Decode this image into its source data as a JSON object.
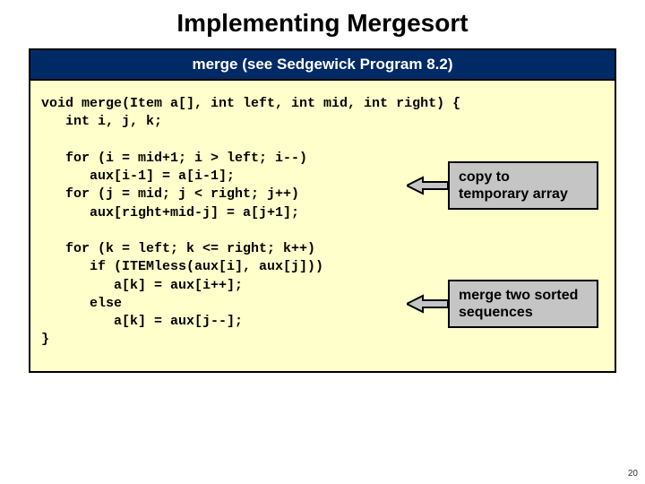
{
  "title": "Implementing Mergesort",
  "panel": {
    "header": "merge (see Sedgewick Program 8.2)",
    "code": "void merge(Item a[], int left, int mid, int right) {\n   int i, j, k;\n\n   for (i = mid+1; i > left; i--)\n      aux[i-1] = a[i-1];\n   for (j = mid; j < right; j++)\n      aux[right+mid-j] = a[j+1];\n\n   for (k = left; k <= right; k++)\n      if (ITEMless(aux[i], aux[j]))\n         a[k] = aux[i++];\n      else\n         a[k] = aux[j--];\n}"
  },
  "callouts": {
    "copy": "copy to\ntemporary array",
    "merge": "merge two sorted\nsequences"
  },
  "page_number": "20"
}
